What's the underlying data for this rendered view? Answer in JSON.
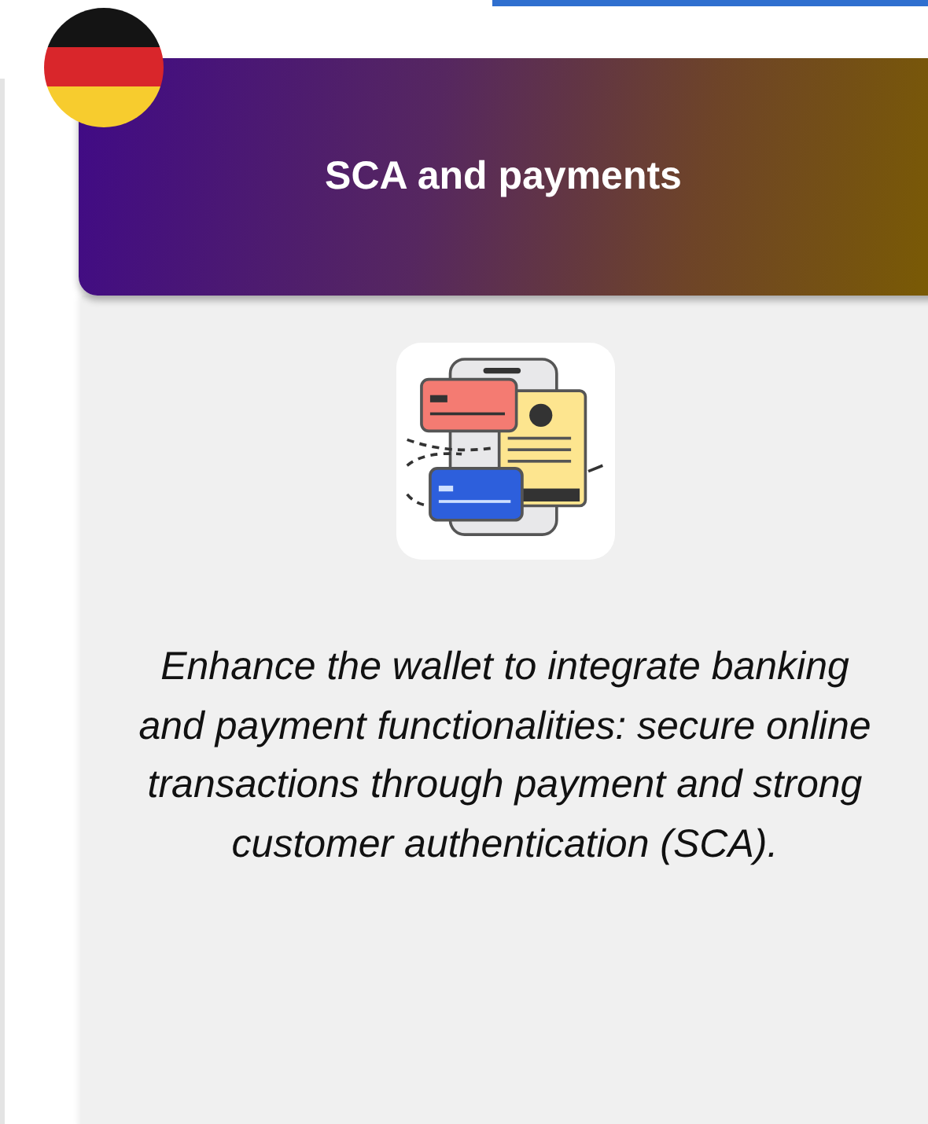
{
  "card": {
    "title": "SCA and payments",
    "description": "Enhance the wallet to integrate banking and payment functionalities: secure online transactions through payment and strong customer authentication (SCA)."
  }
}
